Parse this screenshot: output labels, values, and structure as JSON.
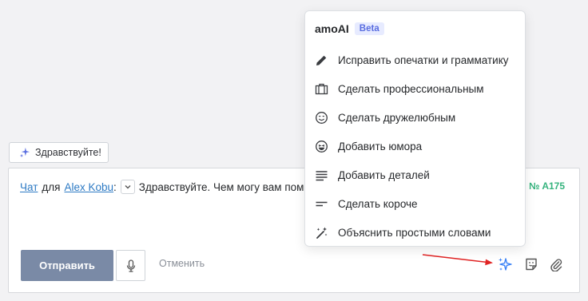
{
  "chip": {
    "label": "Здравствуйте!"
  },
  "composer": {
    "channel_link": "Чат",
    "for_word": "для",
    "contact_link": "Alex Kobu",
    "colon": ":",
    "message_text": "Здравствуйте. Чем могу вам пом",
    "order_ref": "№ A175",
    "send_label": "Отправить",
    "cancel_label": "Отменить"
  },
  "menu": {
    "brand": "amoAI",
    "badge": "Beta",
    "items": [
      {
        "label": "Исправить опечатки и грамматику",
        "icon": "pencil-icon"
      },
      {
        "label": "Сделать профессиональным",
        "icon": "briefcase-icon"
      },
      {
        "label": "Сделать дружелюбным",
        "icon": "smile-icon"
      },
      {
        "label": "Добавить юмора",
        "icon": "laugh-icon"
      },
      {
        "label": "Добавить деталей",
        "icon": "lines-icon"
      },
      {
        "label": "Сделать короче",
        "icon": "short-lines-icon"
      },
      {
        "label": "Объяснить простыми словами",
        "icon": "magic-wand-icon"
      }
    ]
  },
  "colors": {
    "link": "#2d7ac4",
    "send_button": "#7a8aa6",
    "order": "#36b37e",
    "badge_text": "#5a6ee0",
    "badge_bg": "#e7ebff",
    "ai_sparkle": "#3b82f6",
    "arrow": "#e02424"
  }
}
